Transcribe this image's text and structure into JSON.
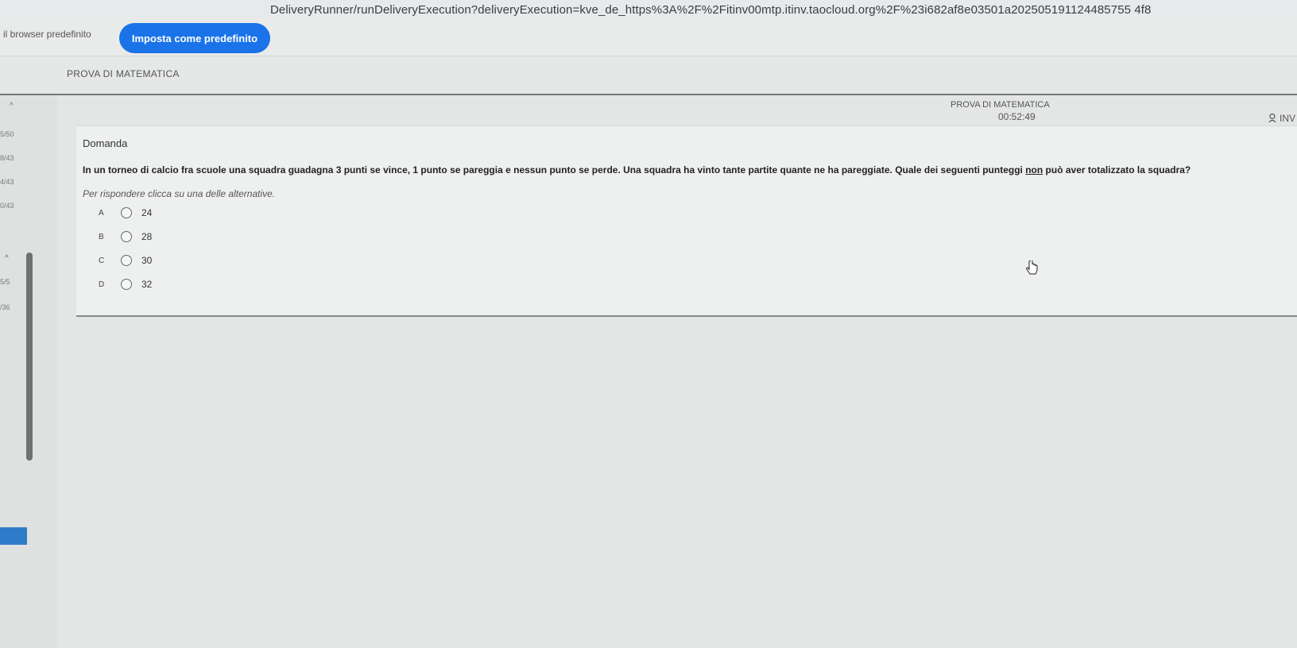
{
  "browser": {
    "url": "DeliveryRunner/runDeliveryExecution?deliveryExecution=kve_de_https%3A%2F%2Fitinv00mtp.itinv.taocloud.org%2F%23i682af8e03501a202505191124485755 4f8",
    "infobar_text": "il browser predefinito",
    "default_button_label": "Imposta come predefinito"
  },
  "header": {
    "test_title": "PROVA DI MATEMATICA",
    "top_title": "PROVA DI MATEMATICA",
    "timer": "00:52:49",
    "user_label": "INV"
  },
  "sidebar": {
    "items": [
      "5/50",
      "8/43",
      "4/43",
      "0/43",
      "5/5",
      "/36"
    ]
  },
  "question": {
    "heading": "Domanda",
    "text_before_emphasis": "In un torneo di calcio fra scuole una squadra guadagna 3 punti se vince, 1 punto se pareggia e nessun punto se perde. Una squadra ha vinto tante partite quante ne ha pareggiate. Quale dei seguenti punteggi ",
    "emphasis": "non",
    "text_after_emphasis": " può aver totalizzato la squadra?",
    "instruction": "Per rispondere clicca su una delle alternative.",
    "choices": [
      {
        "letter": "A",
        "value": "24"
      },
      {
        "letter": "B",
        "value": "28"
      },
      {
        "letter": "C",
        "value": "30"
      },
      {
        "letter": "D",
        "value": "32"
      }
    ]
  }
}
